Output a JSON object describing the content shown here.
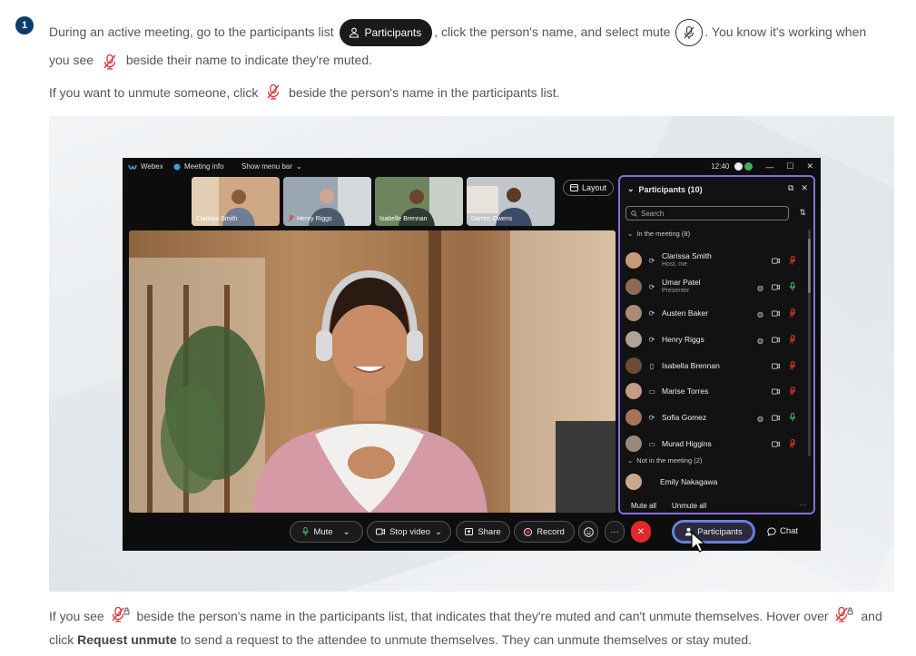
{
  "step": {
    "number": "1"
  },
  "intro": {
    "text_before_participants": "During an active meeting, go to the participants list",
    "participants_button_label": "Participants",
    "text_after_participants": ", click the person's name, and select mute",
    "text_after_mute": ". You know it's working when",
    "text_you_see": "you see",
    "text_end": "beside their name to indicate they're muted."
  },
  "unmute_note": {
    "text_before_icon": "If you want to unmute someone, click",
    "text_after_icon": "beside the person's name in the participants list."
  },
  "footer_note": {
    "text_before_icon": "If you see",
    "text_middle": "beside the person's name in the participants list, that indicates that they're muted and can't unmute themselves. Hover over",
    "text_and": "and",
    "text_click": "click",
    "request_unmute_label": "Request unmute",
    "text_end": "to send a request to the attendee to unmute themselves. They can unmute themselves or stay muted."
  },
  "app": {
    "brand": "Webex",
    "meeting_info": "Meeting info",
    "show_menu_bar": "Show menu bar",
    "clock": "12:40",
    "layout_label": "Layout",
    "thumbnails": [
      {
        "name": "Clarissa Smith",
        "muted": false,
        "bg": "#c9a27c"
      },
      {
        "name": "Henry Riggs",
        "muted": true,
        "bg": "#8c98a4"
      },
      {
        "name": "Isabelle Brennan",
        "muted": false,
        "bg": "#6b7e5a"
      },
      {
        "name": "Darren Owens",
        "muted": false,
        "bg": "#b7bcc2"
      }
    ],
    "participants_panel": {
      "title": "Participants (10)",
      "search_placeholder": "Search",
      "in_meeting_label": "In the meeting (8)",
      "not_in_meeting_label": "Not in the meeting (2)",
      "people": [
        {
          "name": "Clarissa Smith",
          "sub": "Host, me",
          "avatar": "#c99779",
          "mic": "muted",
          "camera": true,
          "share": false
        },
        {
          "name": "Umar Patel",
          "sub": "Presenter",
          "avatar": "#8d6a52",
          "mic": "on",
          "camera": true,
          "share": true
        },
        {
          "name": "Austen Baker",
          "sub": "",
          "avatar": "#a98c73",
          "mic": "muted",
          "camera": true,
          "share": true
        },
        {
          "name": "Henry Riggs",
          "sub": "",
          "avatar": "#b0a297",
          "mic": "muted",
          "camera": true,
          "share": true
        },
        {
          "name": "Isabella Brennan",
          "sub": "",
          "avatar": "#6d4a35",
          "mic": "muted",
          "camera": true,
          "share": false
        },
        {
          "name": "Marise Torres",
          "sub": "",
          "avatar": "#c59c86",
          "mic": "muted",
          "camera": true,
          "share": false
        },
        {
          "name": "Sofia Gomez",
          "sub": "",
          "avatar": "#a67456",
          "mic": "on",
          "camera": true,
          "share": true
        },
        {
          "name": "Murad Higgins",
          "sub": "",
          "avatar": "#9a8a7c",
          "mic": "muted",
          "camera": true,
          "share": false
        }
      ],
      "not_in_meeting": [
        {
          "name": "Emily Nakagawa",
          "avatar": "#c9a88e"
        }
      ],
      "mute_all": "Mute all",
      "unmute_all": "Unmute all",
      "more": "···"
    },
    "controls": {
      "mute": "Mute",
      "stop_video": "Stop video",
      "share": "Share",
      "record": "Record",
      "more": "···",
      "participants": "Participants",
      "chat": "Chat"
    },
    "colors": {
      "muted_red": "#e0353b",
      "mic_green": "#3bd16f",
      "panel_border": "#8a6be0",
      "end_red": "#e3282c"
    }
  }
}
